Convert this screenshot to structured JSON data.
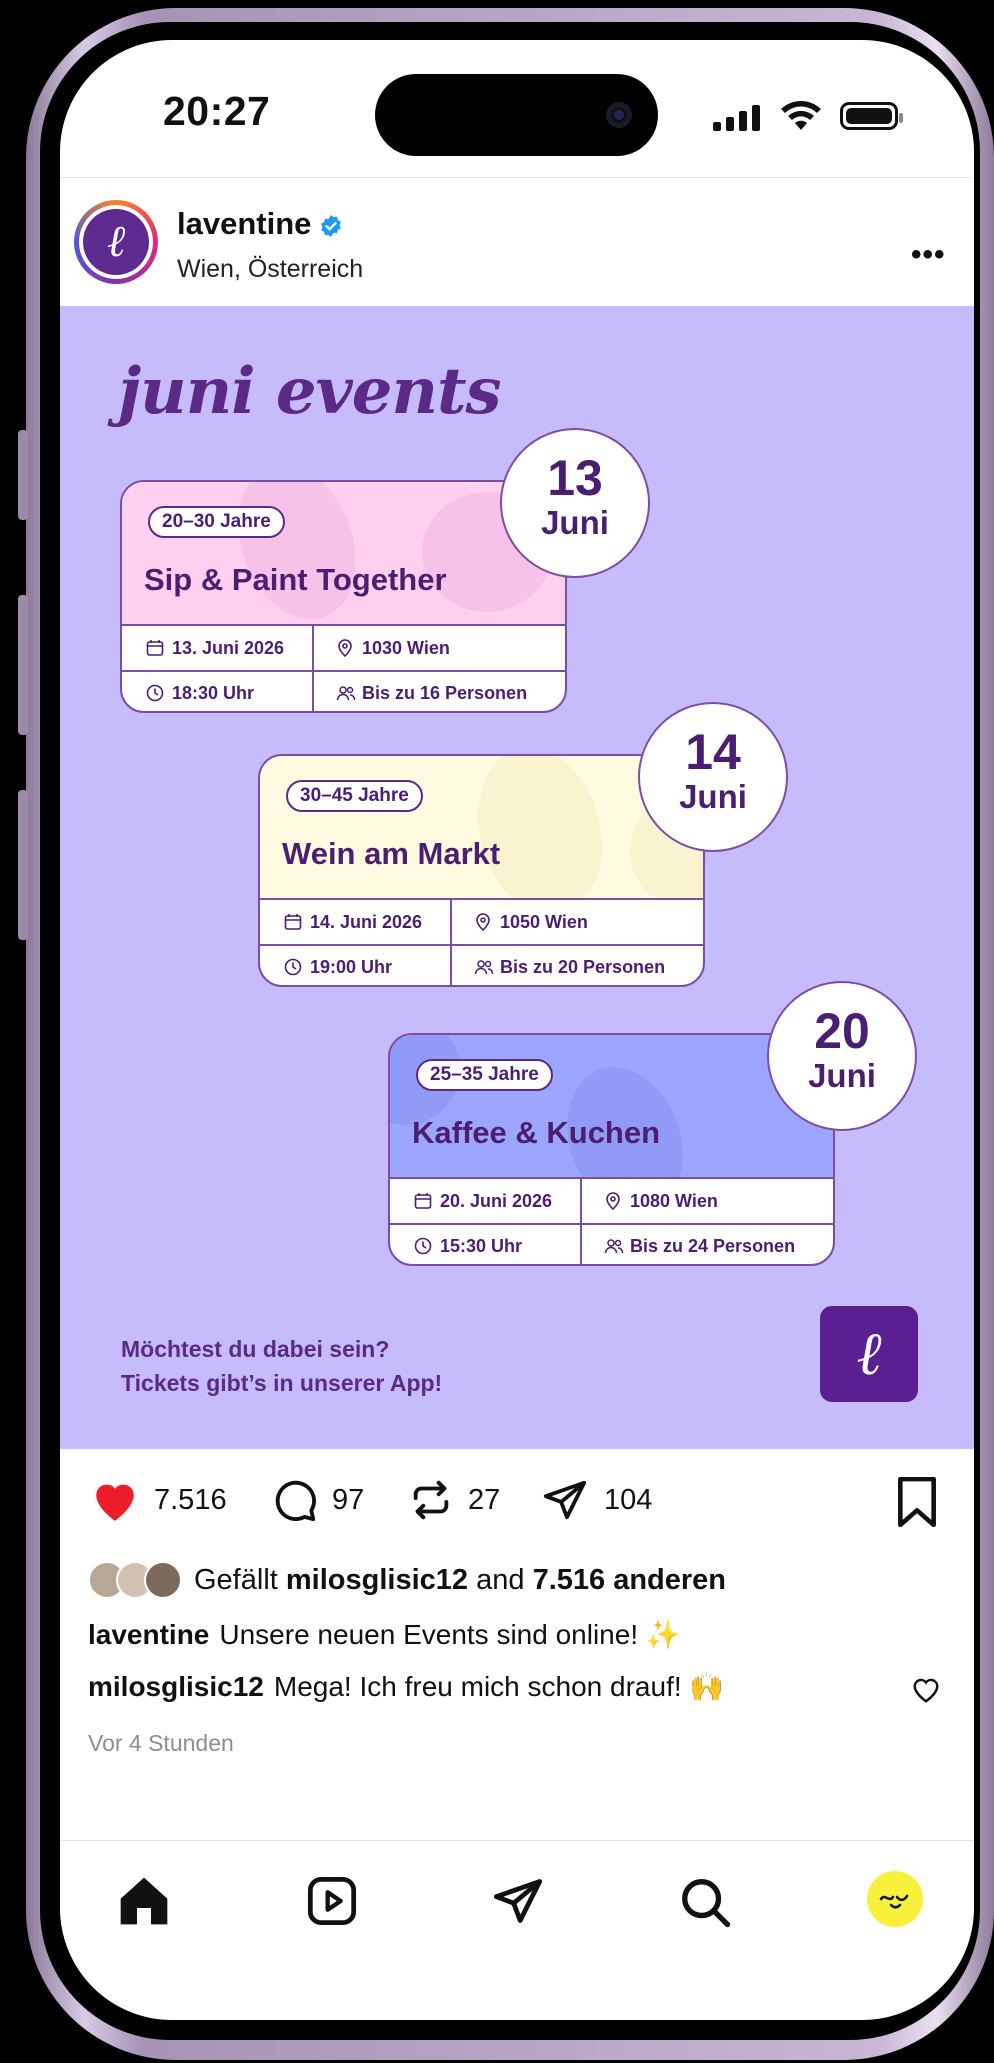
{
  "status": {
    "time": "20:27"
  },
  "post": {
    "username": "laventine",
    "location": "Wien, Österreich",
    "avatar_letter": "ℓ",
    "more": "•••"
  },
  "image": {
    "title": "juni events",
    "events": [
      {
        "age": "20–30 Jahre",
        "title": "Sip & Paint Together",
        "date": "13. Juni 2026",
        "place": "1030 Wien",
        "time": "18:30 Uhr",
        "people": "Bis zu 16 Personen",
        "day": "13",
        "month": "Juni",
        "color": "#ffcff0"
      },
      {
        "age": "30–45 Jahre",
        "title": "Wein am Markt",
        "date": "14. Juni 2026",
        "place": "1050 Wien",
        "time": "19:00 Uhr",
        "people": "Bis zu 20 Personen",
        "day": "14",
        "month": "Juni",
        "color": "#fffbe0"
      },
      {
        "age": "25–35 Jahre",
        "title": "Kaffee & Kuchen",
        "date": "20. Juni 2026",
        "place": "1080 Wien",
        "time": "15:30 Uhr",
        "people": "Bis zu 24 Personen",
        "day": "20",
        "month": "Juni",
        "color": "#9da6ff"
      }
    ],
    "cta_line1": "Möchtest du dabei sein?",
    "cta_line2": "Tickets gibt’s in unserer App!",
    "logo_letter": "ℓ"
  },
  "actions": {
    "likes": "7.516",
    "comments": "97",
    "reposts": "27",
    "shares": "104"
  },
  "liked_by": {
    "prefix": "Gefällt",
    "user": "milosglisic12",
    "and": "and",
    "others": "7.516 anderen"
  },
  "caption": {
    "user": "laventine",
    "text": "Unsere neuen Events sind online! ✨"
  },
  "comment": {
    "user": "milosglisic12",
    "text": "Mega! Ich freu mich schon drauf! 🙌"
  },
  "time_ago": "Vor 4 Stunden",
  "colors": {
    "brand_purple": "#5b2a86",
    "image_bg": "#c6bcfc",
    "like_red": "#ed1c2a"
  }
}
